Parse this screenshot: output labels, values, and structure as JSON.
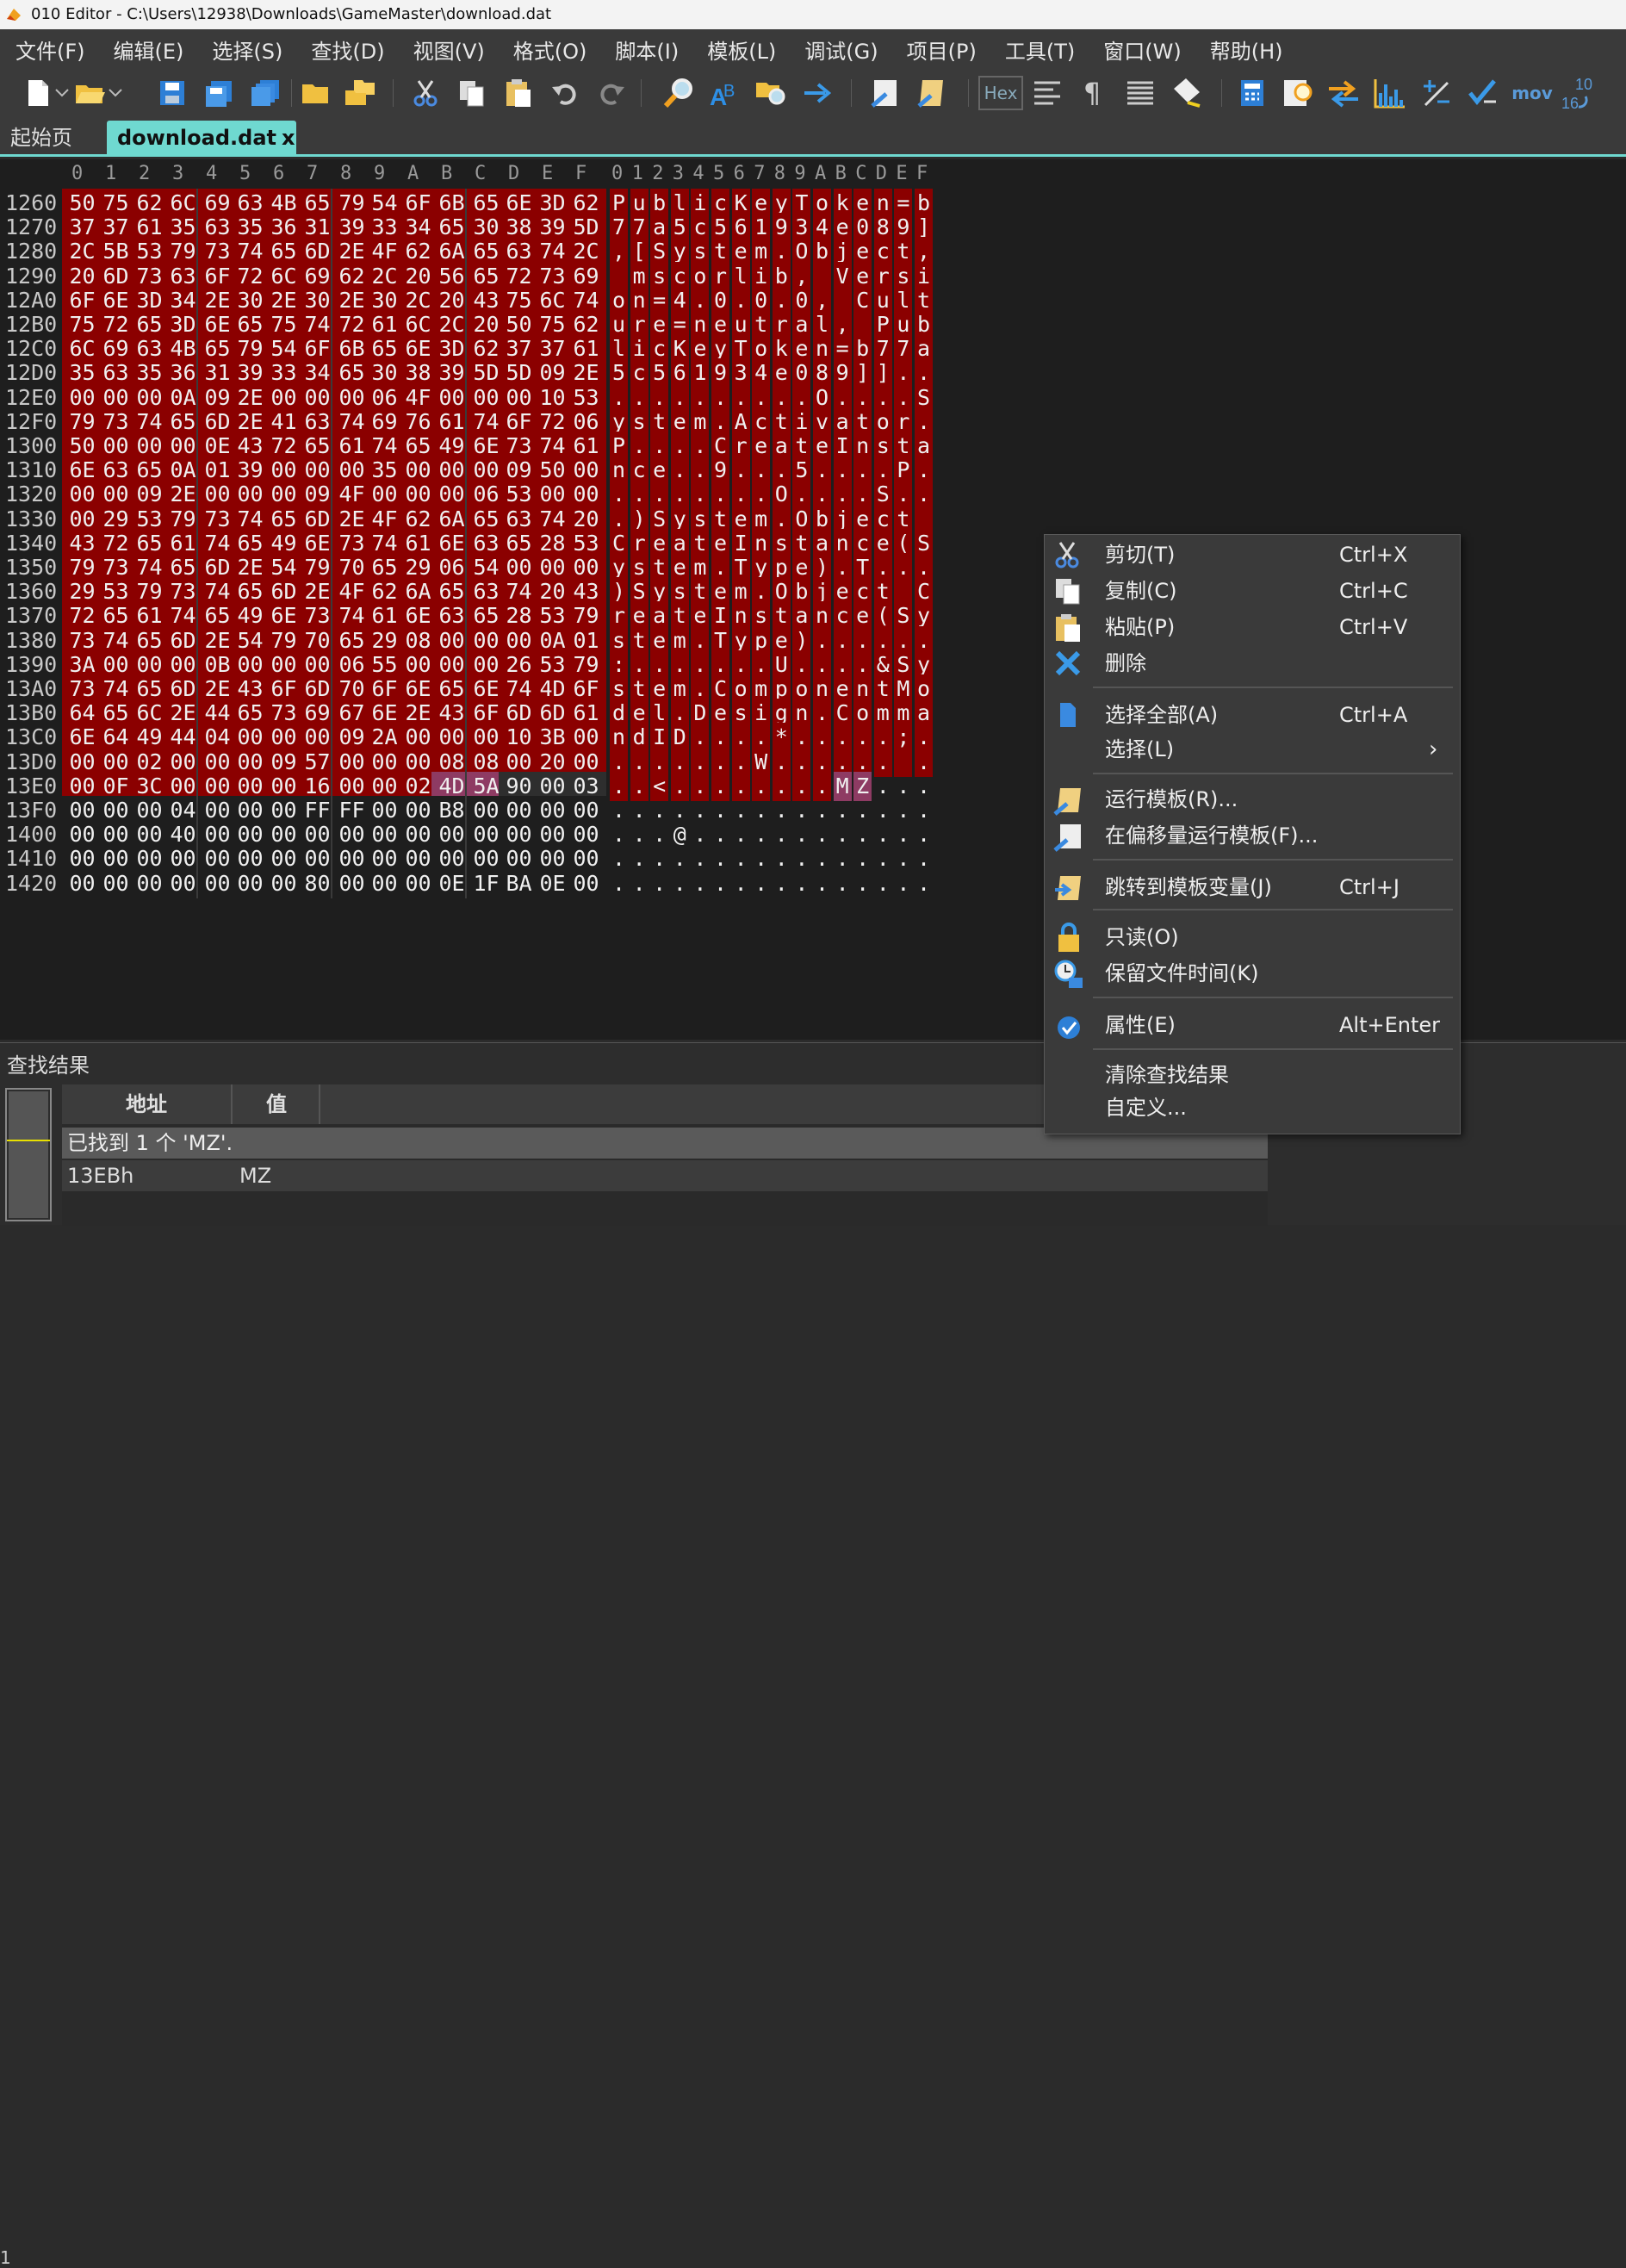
{
  "window": {
    "title": "010 Editor - C:\\Users\\12938\\Downloads\\GameMaster\\download.dat"
  },
  "menu": [
    "文件(F)",
    "编辑(E)",
    "选择(S)",
    "查找(D)",
    "视图(V)",
    "格式(O)",
    "脚本(I)",
    "模板(L)",
    "调试(G)",
    "项目(P)",
    "工具(T)",
    "窗口(W)",
    "帮助(H)"
  ],
  "toolbar": {
    "hex_label": "Hex",
    "mov_label": "mov",
    "base_label_top": "10",
    "base_label_bottom": "16"
  },
  "tabs": {
    "start": "起始页",
    "file": "download.dat",
    "close": "x"
  },
  "editor": {
    "col_headers": [
      "0",
      "1",
      "2",
      "3",
      "4",
      "5",
      "6",
      "7",
      "8",
      "9",
      "A",
      "B",
      "C",
      "D",
      "E",
      "F"
    ],
    "rows": [
      {
        "addr": "1260",
        "hex": [
          "50",
          "75",
          "62",
          "6C",
          "69",
          "63",
          "4B",
          "65",
          "79",
          "54",
          "6F",
          "6B",
          "65",
          "6E",
          "3D",
          "62"
        ],
        "ascii": "PublicKeyToken=b"
      },
      {
        "addr": "1270",
        "hex": [
          "37",
          "37",
          "61",
          "35",
          "63",
          "35",
          "36",
          "31",
          "39",
          "33",
          "34",
          "65",
          "30",
          "38",
          "39",
          "5D"
        ],
        "ascii": "77a5c561934e089]"
      },
      {
        "addr": "1280",
        "hex": [
          "2C",
          "5B",
          "53",
          "79",
          "73",
          "74",
          "65",
          "6D",
          "2E",
          "4F",
          "62",
          "6A",
          "65",
          "63",
          "74",
          "2C"
        ],
        "ascii": ",[System.Object,"
      },
      {
        "addr": "1290",
        "hex": [
          "20",
          "6D",
          "73",
          "63",
          "6F",
          "72",
          "6C",
          "69",
          "62",
          "2C",
          "20",
          "56",
          "65",
          "72",
          "73",
          "69"
        ],
        "ascii": " mscorlib, Versi"
      },
      {
        "addr": "12A0",
        "hex": [
          "6F",
          "6E",
          "3D",
          "34",
          "2E",
          "30",
          "2E",
          "30",
          "2E",
          "30",
          "2C",
          "20",
          "43",
          "75",
          "6C",
          "74"
        ],
        "ascii": "on=4.0.0.0, Cult"
      },
      {
        "addr": "12B0",
        "hex": [
          "75",
          "72",
          "65",
          "3D",
          "6E",
          "65",
          "75",
          "74",
          "72",
          "61",
          "6C",
          "2C",
          "20",
          "50",
          "75",
          "62"
        ],
        "ascii": "ure=neutral, Pub"
      },
      {
        "addr": "12C0",
        "hex": [
          "6C",
          "69",
          "63",
          "4B",
          "65",
          "79",
          "54",
          "6F",
          "6B",
          "65",
          "6E",
          "3D",
          "62",
          "37",
          "37",
          "61"
        ],
        "ascii": "licKeyToken=b77a"
      },
      {
        "addr": "12D0",
        "hex": [
          "35",
          "63",
          "35",
          "36",
          "31",
          "39",
          "33",
          "34",
          "65",
          "30",
          "38",
          "39",
          "5D",
          "5D",
          "09",
          "2E"
        ],
        "ascii": "5c561934e089]].."
      },
      {
        "addr": "12E0",
        "hex": [
          "00",
          "00",
          "00",
          "0A",
          "09",
          "2E",
          "00",
          "00",
          "00",
          "06",
          "4F",
          "00",
          "00",
          "00",
          "10",
          "53"
        ],
        "ascii": "..........O....S"
      },
      {
        "addr": "12F0",
        "hex": [
          "79",
          "73",
          "74",
          "65",
          "6D",
          "2E",
          "41",
          "63",
          "74",
          "69",
          "76",
          "61",
          "74",
          "6F",
          "72",
          "06"
        ],
        "ascii": "ystem.Activator."
      },
      {
        "addr": "1300",
        "hex": [
          "50",
          "00",
          "00",
          "00",
          "0E",
          "43",
          "72",
          "65",
          "61",
          "74",
          "65",
          "49",
          "6E",
          "73",
          "74",
          "61"
        ],
        "ascii": "P....CreateInsta"
      },
      {
        "addr": "1310",
        "hex": [
          "6E",
          "63",
          "65",
          "0A",
          "01",
          "39",
          "00",
          "00",
          "00",
          "35",
          "00",
          "00",
          "00",
          "09",
          "50",
          "00"
        ],
        "ascii": "nce..9...5....P."
      },
      {
        "addr": "1320",
        "hex": [
          "00",
          "00",
          "09",
          "2E",
          "00",
          "00",
          "00",
          "09",
          "4F",
          "00",
          "00",
          "00",
          "06",
          "53",
          "00",
          "00"
        ],
        "ascii": "........O....S.."
      },
      {
        "addr": "1330",
        "hex": [
          "00",
          "29",
          "53",
          "79",
          "73",
          "74",
          "65",
          "6D",
          "2E",
          "4F",
          "62",
          "6A",
          "65",
          "63",
          "74",
          "20"
        ],
        "ascii": ".)System.Object "
      },
      {
        "addr": "1340",
        "hex": [
          "43",
          "72",
          "65",
          "61",
          "74",
          "65",
          "49",
          "6E",
          "73",
          "74",
          "61",
          "6E",
          "63",
          "65",
          "28",
          "53"
        ],
        "ascii": "CreateInstance(S"
      },
      {
        "addr": "1350",
        "hex": [
          "79",
          "73",
          "74",
          "65",
          "6D",
          "2E",
          "54",
          "79",
          "70",
          "65",
          "29",
          "06",
          "54",
          "00",
          "00",
          "00"
        ],
        "ascii": "ystem.Type).T..."
      },
      {
        "addr": "1360",
        "hex": [
          "29",
          "53",
          "79",
          "73",
          "74",
          "65",
          "6D",
          "2E",
          "4F",
          "62",
          "6A",
          "65",
          "63",
          "74",
          "20",
          "43"
        ],
        "ascii": ")System.Object C"
      },
      {
        "addr": "1370",
        "hex": [
          "72",
          "65",
          "61",
          "74",
          "65",
          "49",
          "6E",
          "73",
          "74",
          "61",
          "6E",
          "63",
          "65",
          "28",
          "53",
          "79"
        ],
        "ascii": "reateInstance(Sy"
      },
      {
        "addr": "1380",
        "hex": [
          "73",
          "74",
          "65",
          "6D",
          "2E",
          "54",
          "79",
          "70",
          "65",
          "29",
          "08",
          "00",
          "00",
          "00",
          "0A",
          "01"
        ],
        "ascii": "stem.Type)......"
      },
      {
        "addr": "1390",
        "hex": [
          "3A",
          "00",
          "00",
          "00",
          "0B",
          "00",
          "00",
          "00",
          "06",
          "55",
          "00",
          "00",
          "00",
          "26",
          "53",
          "79"
        ],
        "ascii": ":.......U....&Sy"
      },
      {
        "addr": "13A0",
        "hex": [
          "73",
          "74",
          "65",
          "6D",
          "2E",
          "43",
          "6F",
          "6D",
          "70",
          "6F",
          "6E",
          "65",
          "6E",
          "74",
          "4D",
          "6F"
        ],
        "ascii": "stem.ComponentMo"
      },
      {
        "addr": "13B0",
        "hex": [
          "64",
          "65",
          "6C",
          "2E",
          "44",
          "65",
          "73",
          "69",
          "67",
          "6E",
          "2E",
          "43",
          "6F",
          "6D",
          "6D",
          "61"
        ],
        "ascii": "del.Design.Comma"
      },
      {
        "addr": "13C0",
        "hex": [
          "6E",
          "64",
          "49",
          "44",
          "04",
          "00",
          "00",
          "00",
          "09",
          "2A",
          "00",
          "00",
          "00",
          "10",
          "3B",
          "00"
        ],
        "ascii": "ndID....*.....;."
      },
      {
        "addr": "13D0",
        "hex": [
          "00",
          "00",
          "02",
          "00",
          "00",
          "00",
          "09",
          "57",
          "00",
          "00",
          "00",
          "08",
          "08",
          "00",
          "20",
          "00"
        ],
        "ascii": ".......W...... ."
      },
      {
        "addr": "13E0",
        "hex": [
          "00",
          "0F",
          "3C",
          "00",
          "00",
          "00",
          "00",
          "16",
          "00",
          "00",
          "02",
          "4D",
          "5A",
          "90",
          "00",
          "03"
        ],
        "ascii": "..<........MZ..."
      },
      {
        "addr": "13F0",
        "hex": [
          "00",
          "00",
          "00",
          "04",
          "00",
          "00",
          "00",
          "FF",
          "FF",
          "00",
          "00",
          "B8",
          "00",
          "00",
          "00",
          "00"
        ],
        "ascii": "................"
      },
      {
        "addr": "1400",
        "hex": [
          "00",
          "00",
          "00",
          "40",
          "00",
          "00",
          "00",
          "00",
          "00",
          "00",
          "00",
          "00",
          "00",
          "00",
          "00",
          "00"
        ],
        "ascii": "...@............"
      },
      {
        "addr": "1410",
        "hex": [
          "00",
          "00",
          "00",
          "00",
          "00",
          "00",
          "00",
          "00",
          "00",
          "00",
          "00",
          "00",
          "00",
          "00",
          "00",
          "00"
        ],
        "ascii": "................"
      },
      {
        "addr": "1420",
        "hex": [
          "00",
          "00",
          "00",
          "00",
          "00",
          "00",
          "00",
          "80",
          "00",
          "00",
          "00",
          "0E",
          "1F",
          "BA",
          "0E",
          "00"
        ],
        "ascii": "................"
      }
    ]
  },
  "find": {
    "title": "查找结果",
    "col_addr": "地址",
    "col_value": "值",
    "summary": "已找到 1 个 'MZ'.",
    "result_addr": "13EBh",
    "result_value": "MZ",
    "line_number": "1"
  },
  "context_menu": {
    "items": [
      {
        "label": "剪切(T)",
        "shortcut": "Ctrl+X",
        "icon": "scissors-icon"
      },
      {
        "label": "复制(C)",
        "shortcut": "Ctrl+C",
        "icon": "copy-icon"
      },
      {
        "label": "粘贴(P)",
        "shortcut": "Ctrl+V",
        "icon": "paste-icon"
      },
      {
        "label": "删除",
        "shortcut": "",
        "icon": "delete-icon"
      },
      {
        "label": "选择全部(A)",
        "shortcut": "Ctrl+A",
        "icon": "select-all-icon"
      },
      {
        "label": "选择(L)",
        "shortcut": "",
        "icon": ""
      },
      {
        "label": "运行模板(R)...",
        "shortcut": "",
        "icon": "run-template-icon"
      },
      {
        "label": "在偏移量运行模板(F)...",
        "shortcut": "",
        "icon": "run-template-offset-icon"
      },
      {
        "label": "跳转到模板变量(J)",
        "shortcut": "Ctrl+J",
        "icon": "jump-template-var-icon"
      },
      {
        "label": "只读(O)",
        "shortcut": "",
        "icon": "lock-icon"
      },
      {
        "label": "保留文件时间(K)",
        "shortcut": "",
        "icon": "clock-lock-icon"
      },
      {
        "label": "属性(E)",
        "shortcut": "Alt+Enter",
        "icon": "properties-icon"
      },
      {
        "label": "清除查找结果",
        "shortcut": "",
        "icon": ""
      },
      {
        "label": "自定义...",
        "shortcut": "",
        "icon": ""
      }
    ]
  },
  "colors": {
    "selection": "#8b0000",
    "highlight": "#8e3b63",
    "tab_active": "#6fd9d0"
  }
}
